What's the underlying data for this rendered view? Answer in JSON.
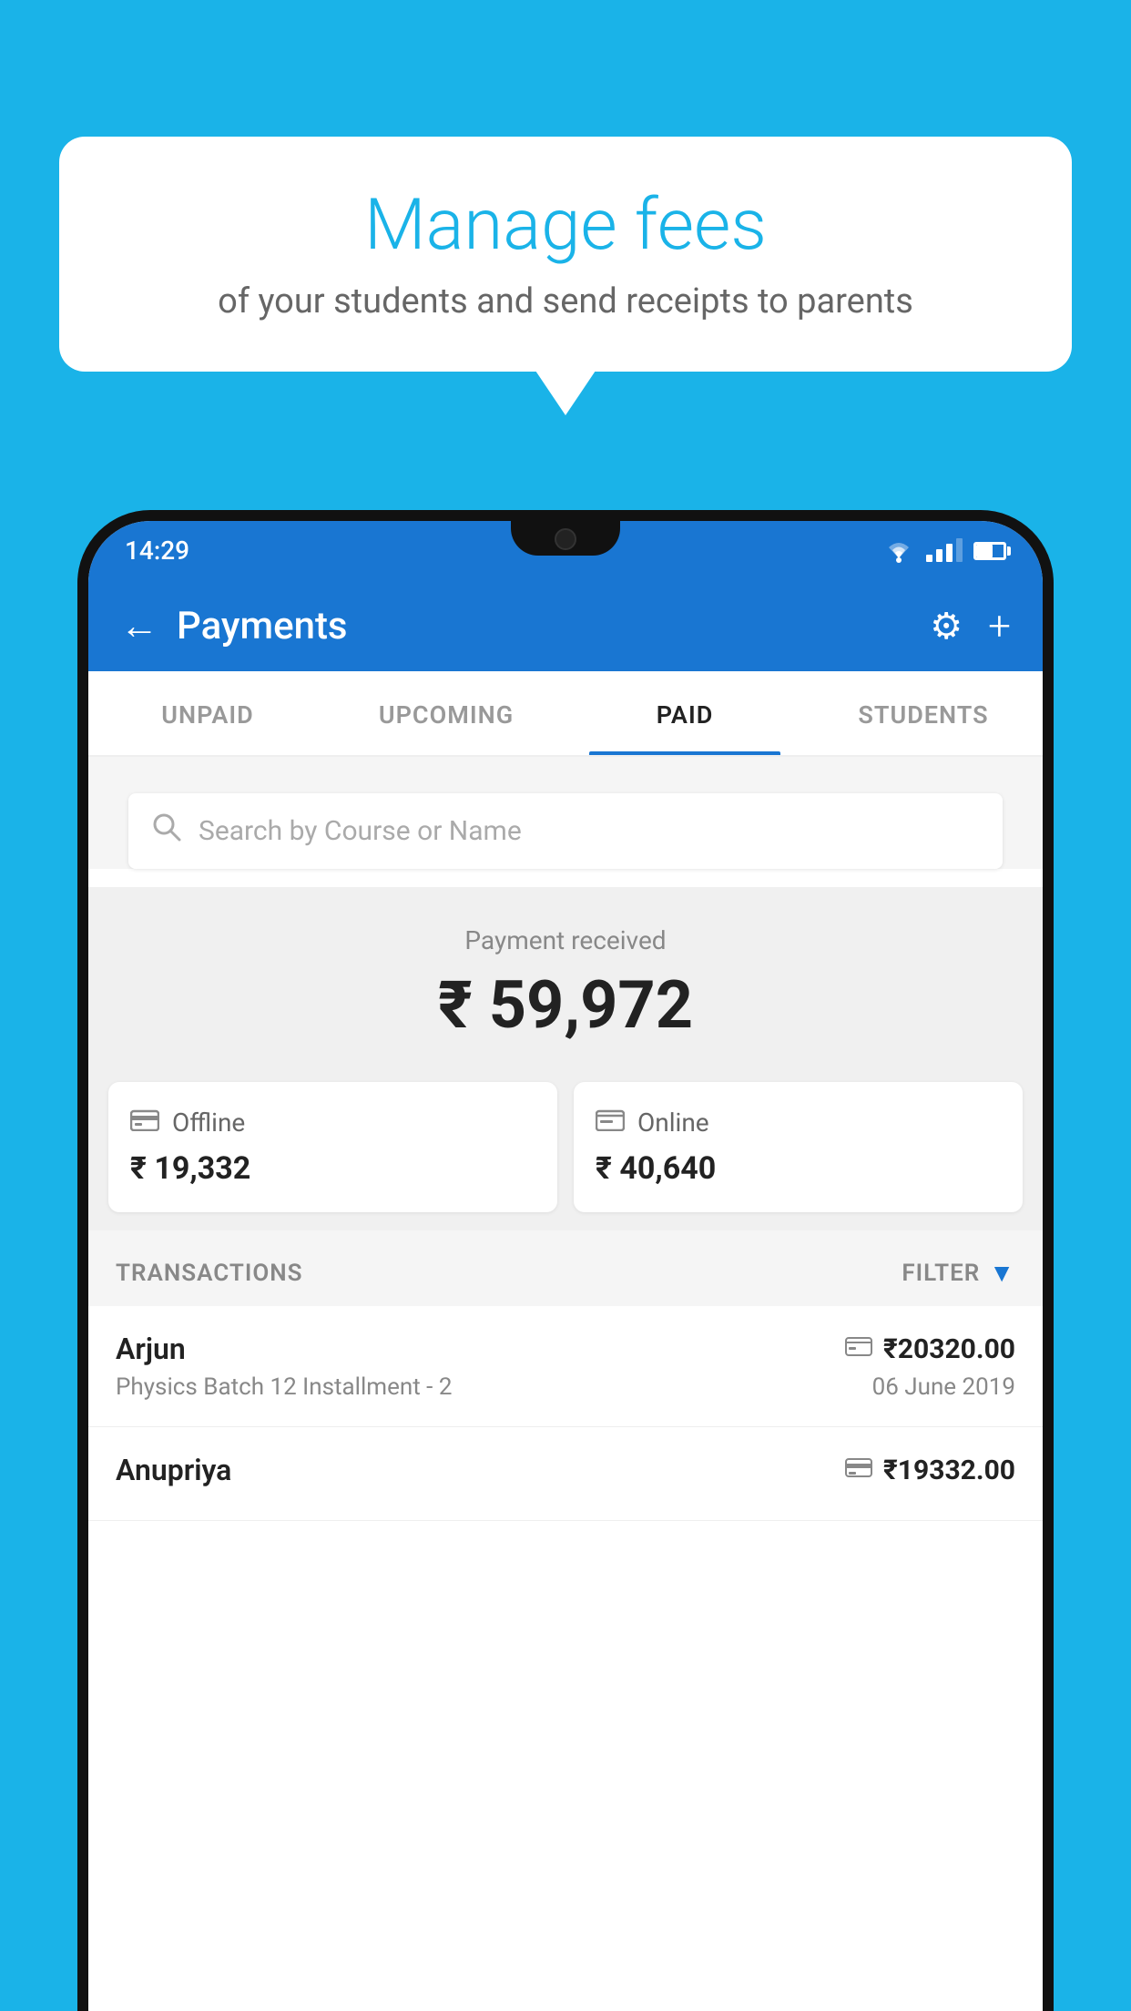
{
  "background_color": "#1ab3e8",
  "speech_bubble": {
    "title": "Manage fees",
    "subtitle": "of your students and send receipts to parents"
  },
  "status_bar": {
    "time": "14:29"
  },
  "app_bar": {
    "title": "Payments",
    "back_label": "←",
    "gear_label": "⚙",
    "plus_label": "+"
  },
  "tabs": [
    {
      "label": "UNPAID",
      "active": false
    },
    {
      "label": "UPCOMING",
      "active": false
    },
    {
      "label": "PAID",
      "active": true
    },
    {
      "label": "STUDENTS",
      "active": false
    }
  ],
  "search": {
    "placeholder": "Search by Course or Name"
  },
  "payment_received": {
    "label": "Payment received",
    "amount": "₹ 59,972"
  },
  "payment_cards": [
    {
      "icon": "💳",
      "label": "Offline",
      "amount": "₹ 19,332"
    },
    {
      "icon": "💳",
      "label": "Online",
      "amount": "₹ 40,640"
    }
  ],
  "transactions": {
    "label": "TRANSACTIONS",
    "filter_label": "FILTER"
  },
  "transaction_rows": [
    {
      "name": "Arjun",
      "type_icon": "💳",
      "amount": "₹20320.00",
      "course": "Physics Batch 12 Installment - 2",
      "date": "06 June 2019"
    },
    {
      "name": "Anupriya",
      "type_icon": "💵",
      "amount": "₹19332.00",
      "course": "",
      "date": ""
    }
  ]
}
